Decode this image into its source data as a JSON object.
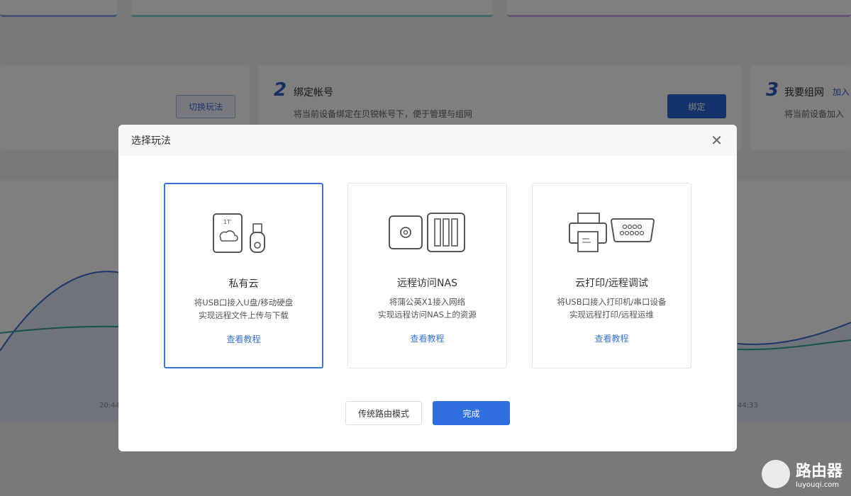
{
  "background": {
    "switch_button": "切换玩法",
    "step2": {
      "num": "2",
      "title": "绑定帐号",
      "desc": "将当前设备绑定在贝锐帐号下，便于管理与组网",
      "button": "绑定"
    },
    "step3": {
      "num": "3",
      "title": "我要组网",
      "link": "加入",
      "desc": "将当前设备加入"
    },
    "chart_ticks": [
      "20:44",
      "44:33"
    ]
  },
  "modal": {
    "title": "选择玩法",
    "options": [
      {
        "title": "私有云",
        "desc1": "将USB口接入U盘/移动硬盘",
        "desc2": "实现远程文件上传与下载",
        "link": "查看教程",
        "icon_label": "1T"
      },
      {
        "title": "远程访问NAS",
        "desc1": "将蒲公英X1接入网络",
        "desc2": "实现远程访问NAS上的资源",
        "link": "查看教程"
      },
      {
        "title": "云打印/远程调试",
        "desc1": "将USB口接入打印机/串口设备",
        "desc2": "实现远程打印/远程运维",
        "link": "查看教程"
      }
    ],
    "secondary_button": "传统路由模式",
    "primary_button": "完成"
  },
  "watermark": {
    "title": "路由器",
    "url": "luyouqi.com"
  }
}
